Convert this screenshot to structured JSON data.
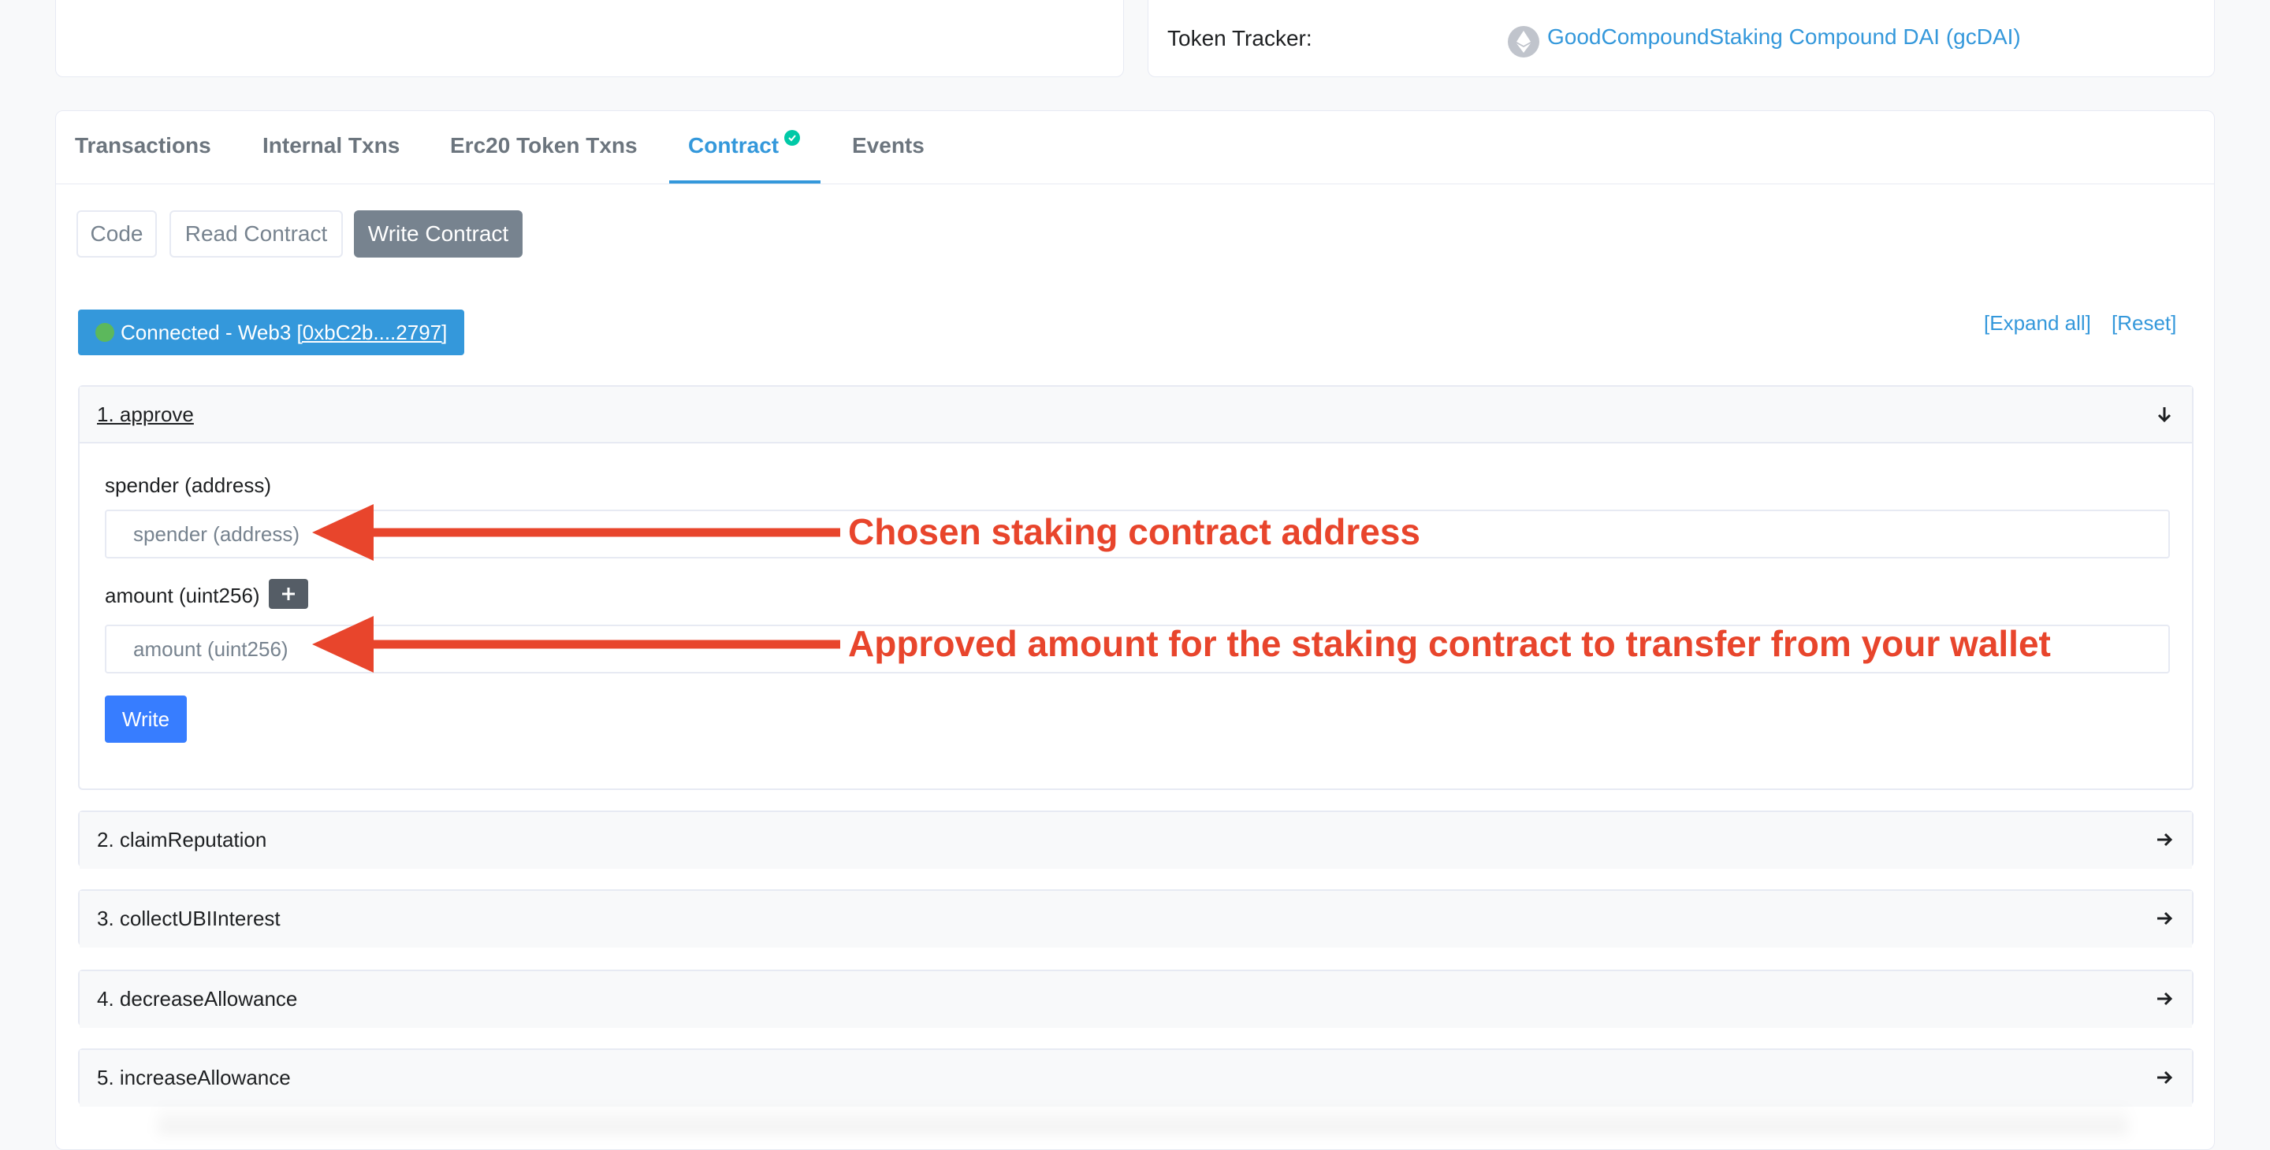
{
  "token_tracker": {
    "label": "Token Tracker:",
    "icon": "ethereum-icon",
    "link_text": "GoodCompoundStaking Compound DAI (gcDAI)"
  },
  "tabs": [
    {
      "label": "Transactions"
    },
    {
      "label": "Internal Txns"
    },
    {
      "label": "Erc20 Token Txns"
    },
    {
      "label": "Contract",
      "active": true
    },
    {
      "label": "Events"
    }
  ],
  "subtabs": [
    {
      "label": "Code"
    },
    {
      "label": "Read Contract"
    },
    {
      "label": "Write Contract",
      "active": true
    }
  ],
  "connection": {
    "prefix": "Connected - Web3 ",
    "address": "[0xbC2b....2797]"
  },
  "links": {
    "expand_all": "[Expand all]",
    "reset": "[Reset]"
  },
  "functions": [
    {
      "title": "1. approve",
      "expanded": true,
      "params": [
        {
          "label": "spender (address)",
          "placeholder": "spender (address)"
        },
        {
          "label": "amount (uint256)",
          "placeholder": "amount (uint256)"
        }
      ],
      "write_label": "Write"
    },
    {
      "title": "2. claimReputation"
    },
    {
      "title": "3. collectUBIInterest"
    },
    {
      "title": "4. decreaseAllowance"
    },
    {
      "title": "5. increaseAllowance"
    }
  ],
  "annotations": [
    "Chosen staking contract address",
    "Approved amount for the staking contract to transfer from your wallet"
  ],
  "colors": {
    "link": "#3498db",
    "primary_button": "#377dff",
    "annotation": "#e8452c",
    "verified": "#00c9a7",
    "connected_dot": "#5cb85c"
  }
}
